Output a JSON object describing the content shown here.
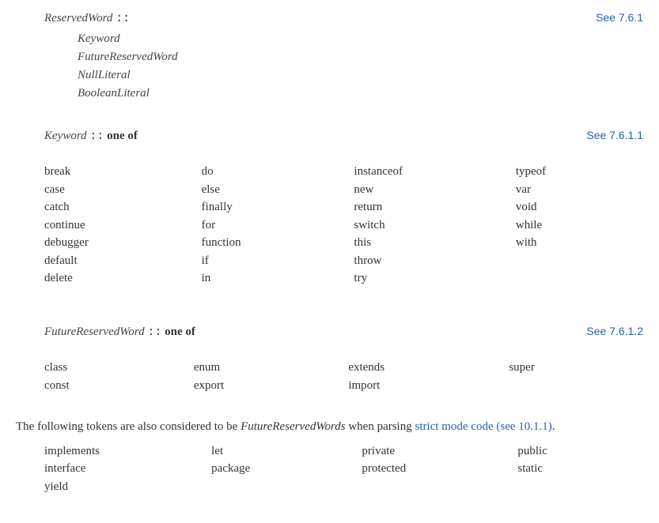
{
  "reserved": {
    "lhs": "ReservedWord",
    "sep": "::",
    "see": "See 7.6.1",
    "alts": [
      "Keyword",
      "FutureReservedWord",
      "NullLiteral",
      "BooleanLiteral"
    ]
  },
  "keyword": {
    "lhs": "Keyword",
    "sep": "::",
    "oneof": "one of",
    "see": "See 7.6.1.1",
    "cols": 4,
    "rows": 7,
    "table": [
      [
        "break",
        "do",
        "instanceof",
        "typeof"
      ],
      [
        "case",
        "else",
        "new",
        "var"
      ],
      [
        "catch",
        "finally",
        "return",
        "void"
      ],
      [
        "continue",
        "for",
        "switch",
        "while"
      ],
      [
        "debugger",
        "function",
        "this",
        "with"
      ],
      [
        "default",
        "if",
        "throw",
        ""
      ],
      [
        "delete",
        "in",
        "try",
        ""
      ]
    ]
  },
  "future": {
    "lhs": "FutureReservedWord",
    "sep": "::",
    "oneof": "one of",
    "see": "See 7.6.1.2",
    "cols": 4,
    "rows": 2,
    "table": [
      [
        "class",
        "enum",
        "extends",
        "super"
      ],
      [
        "const",
        "export",
        "import",
        ""
      ]
    ]
  },
  "strict_para": {
    "prefix": "The following tokens are also considered to be ",
    "ital": "FutureReservedWords",
    "mid": " when parsing ",
    "link": "strict mode code (see 10.1.1)",
    "suffix": "."
  },
  "strict": {
    "cols": 4,
    "rows": 3,
    "table": [
      [
        "implements",
        "let",
        "private",
        "public"
      ],
      [
        "interface",
        "package",
        "protected",
        "static"
      ],
      [
        "yield",
        "",
        "",
        ""
      ]
    ]
  }
}
